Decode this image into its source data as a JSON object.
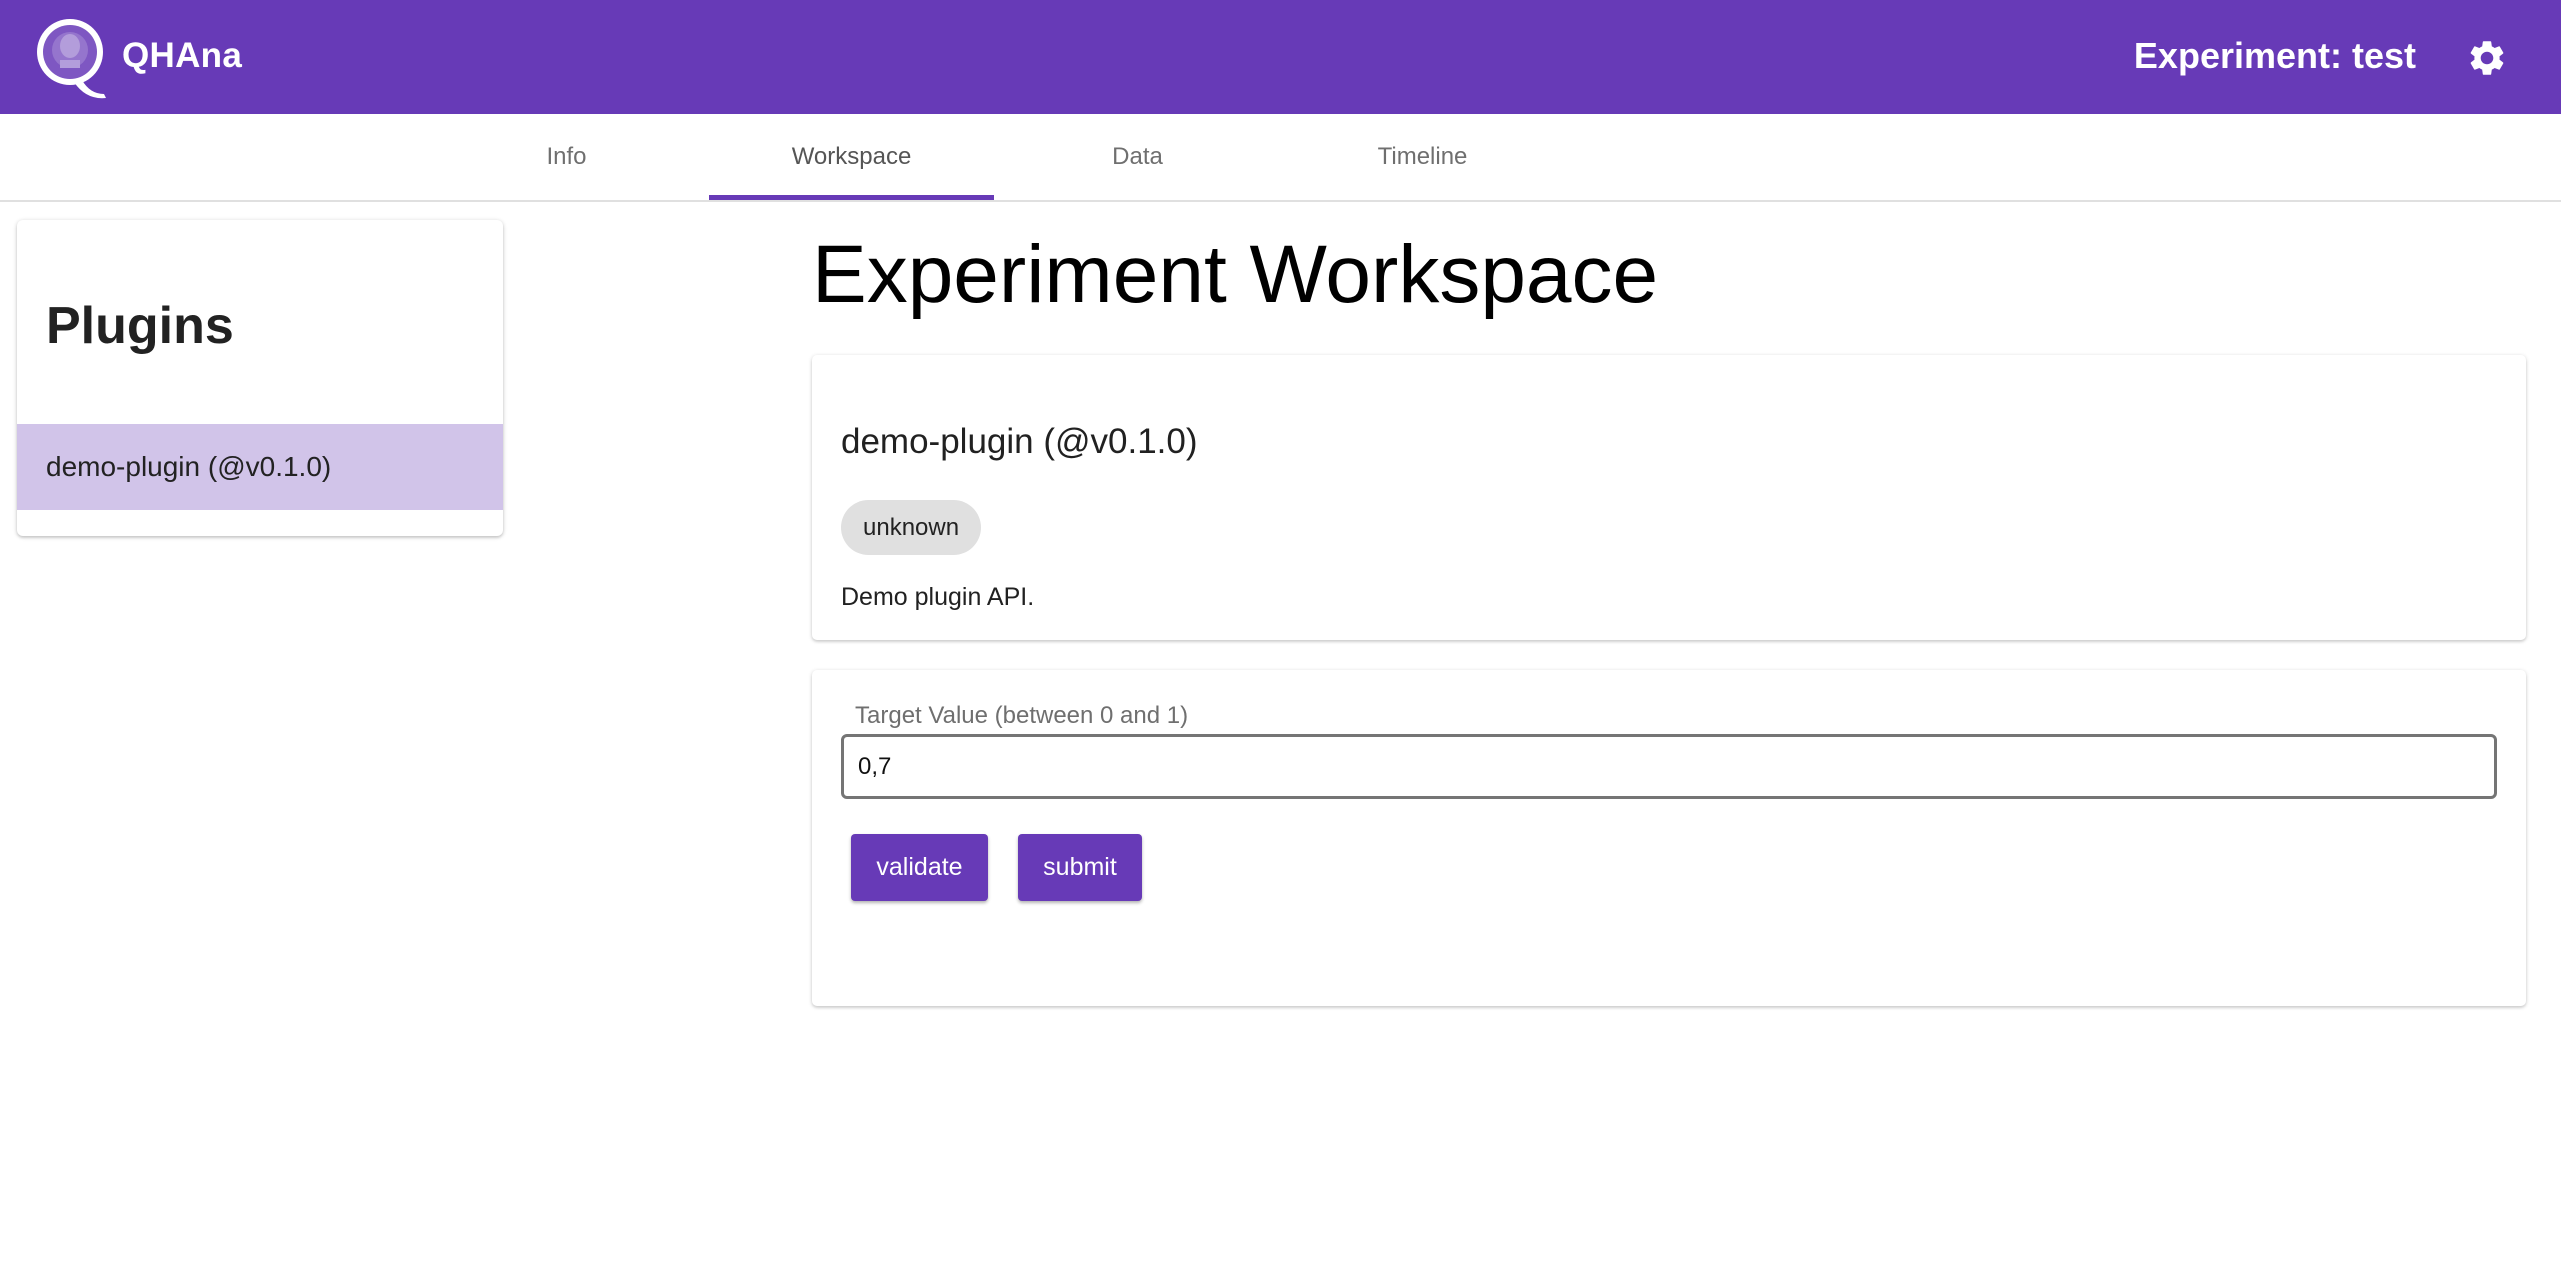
{
  "header": {
    "app_name": "QHAna",
    "experiment_title": "Experiment: test",
    "settings_icon": "gear-icon",
    "logo_icon": "qhana-logo-icon",
    "bar_color": "#673ab7"
  },
  "tabs": [
    {
      "label": "Info",
      "active": false
    },
    {
      "label": "Workspace",
      "active": true
    },
    {
      "label": "Data",
      "active": false
    },
    {
      "label": "Timeline",
      "active": false
    }
  ],
  "sidebar": {
    "title": "Plugins",
    "items": [
      {
        "label": "demo-plugin (@v0.1.0)",
        "selected": true
      }
    ],
    "selected_color": "#d1c4e9"
  },
  "main": {
    "title": "Experiment Workspace",
    "plugin": {
      "name": "demo-plugin (@v0.1.0)",
      "tag": "unknown",
      "description": "Demo plugin API."
    },
    "form": {
      "field_label": "Target Value (between 0 and 1)",
      "field_value": "0,7",
      "validate_label": "validate",
      "submit_label": "submit"
    }
  }
}
